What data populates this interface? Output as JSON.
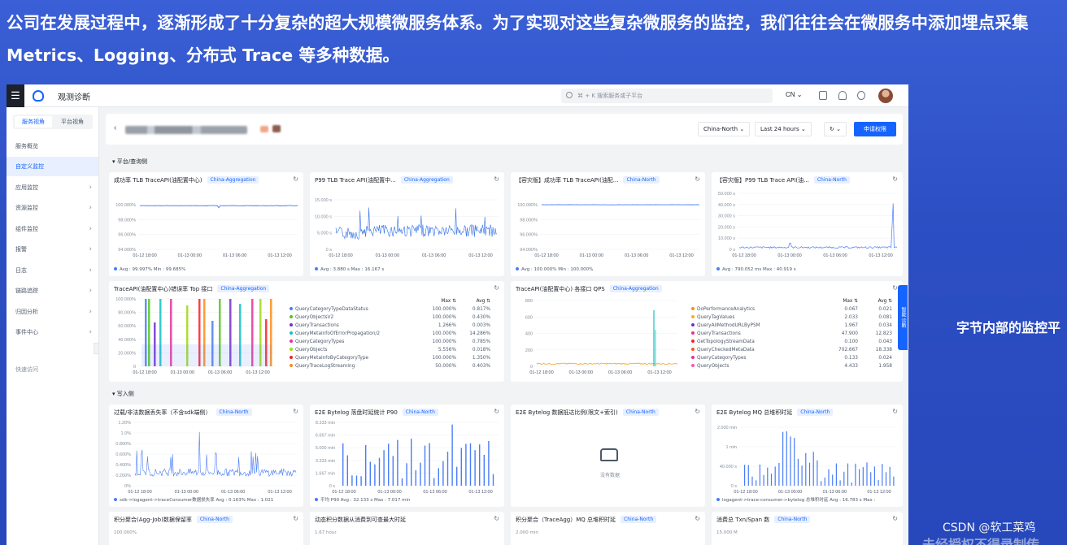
{
  "slide": {
    "heading": "公司在发展过程中，逐渐形成了十分复杂的超大规模微服务体系。为了实现对这些复杂微服务的监控，我们往往会在微服务中添加埋点采集 Metrics、Logging、分布式 Trace 等多种数据。",
    "side_note": "字节内部的监控平",
    "watermark": "CSDN @软工菜鸡",
    "watermark2": "未经授权不得录制传"
  },
  "app": {
    "name": "观测诊断",
    "search_placeholder": "⌘ + K 搜索服务或子平台",
    "lang": "CN ⌄",
    "float_tab": "智能 诊断"
  },
  "sidebar": {
    "seg_on": "服务视角",
    "seg_off": "平台视角",
    "items": [
      {
        "label": "服务概览",
        "chevron": ""
      },
      {
        "label": "自定义监控",
        "chevron": ""
      },
      {
        "label": "应用监控",
        "chevron": "›"
      },
      {
        "label": "资源监控",
        "chevron": "›"
      },
      {
        "label": "组件监控",
        "chevron": "›"
      },
      {
        "label": "报警",
        "chevron": "›"
      },
      {
        "label": "日志",
        "chevron": "›"
      },
      {
        "label": "链路追踪",
        "chevron": "›"
      },
      {
        "label": "归因分析",
        "chevron": "›"
      },
      {
        "label": "事件中心",
        "chevron": "›"
      }
    ],
    "bottom": "快速访问"
  },
  "pagebar": {
    "back": "‹",
    "region": "China-North ⌄",
    "range": "Last 24 hours ⌄",
    "refresh": "↻ ⌄",
    "apply": "申请权限"
  },
  "groups": {
    "g1": "▾ 平台/查询侧",
    "g2": "▾ 写入侧"
  },
  "panels": {
    "p1": {
      "title": "成功率 TLB TraceAPI(油配置中心)",
      "tag": "China-Aggregation",
      "legend": "Avg : 99.997% Min : 99.685%",
      "yticks": [
        "100.000%",
        "98.000%",
        "96.000%",
        "94.000%"
      ],
      "xticks": [
        "01-12 18:00",
        "01-13 00:00",
        "01-13 06:00",
        "01-13 12:00"
      ]
    },
    "p2": {
      "title": "P99 TLB Trace API(油配置中...",
      "tag": "China-Aggregation",
      "legend": "Avg : 3.880 s Max : 16.167 s",
      "yticks": [
        "15.000 s",
        "10.000 s",
        "5.000 s",
        "0 s"
      ],
      "xticks": [
        "01-12 18:00",
        "01-13 00:00",
        "01-13 06:00",
        "01-13 12:00"
      ]
    },
    "p3": {
      "title": "【容灾版】成功率 TLB TraceAPI(油配...",
      "tag": "China-North",
      "legend": "Avg : 100.000% Min : 100.000%",
      "yticks": [
        "100.000%",
        "98.000%",
        "96.000%",
        "94.000%"
      ],
      "xticks": [
        "01-12 18:00",
        "01-13 00:00",
        "01-13 06:00",
        "01-13 12:00"
      ]
    },
    "p4": {
      "title": "【容灾版】P99 TLB Trace API(油...",
      "tag": "China-North",
      "legend": "Avg : 790.052 ms Max : 40.919 s",
      "yticks": [
        "50.000 s",
        "40.000 s",
        "30.000 s",
        "20.000 s",
        "10.000 s",
        "0 s"
      ],
      "xticks": [
        "01-12 18:00",
        "01-13 00:00",
        "01-13 06:00",
        "01-13 12:00"
      ]
    },
    "p5": {
      "title": "TraceAPI(油配置中心)错误率 Top 接口",
      "tag": "China-Aggregation",
      "yticks": [
        "100.000%",
        "80.000%",
        "60.000%",
        "40.000%",
        "20.000%",
        "0"
      ],
      "xticks": [
        "01-12 18:00",
        "01-13 00:00",
        "01-13 06:00",
        "01-13 12:00"
      ],
      "head": {
        "max": "Max ⇅",
        "avg": "Avg ⇅"
      },
      "rows": [
        {
          "name": "QueryCategoryTypeDataStatus",
          "max": "100.000%",
          "avg": "0.817%",
          "color": "#4a7df7"
        },
        {
          "name": "QueryObjectsV2",
          "max": "100.000%",
          "avg": "0.430%",
          "color": "#52c41a"
        },
        {
          "name": "QueryTransactions",
          "max": "1.266%",
          "avg": "0.003%",
          "color": "#722ed1"
        },
        {
          "name": "QueryMetainfoOfErrorPropagation/2",
          "max": "100.000%",
          "avg": "14.286%",
          "color": "#13c2c2"
        },
        {
          "name": "QueryCategoryTypes",
          "max": "100.000%",
          "avg": "0.785%",
          "color": "#eb2f96"
        },
        {
          "name": "QueryObjects",
          "max": "5.556%",
          "avg": "0.018%",
          "color": "#a0d911"
        },
        {
          "name": "QueryMetainfoByCategoryType",
          "max": "100.000%",
          "avg": "1.350%",
          "color": "#f5222d"
        },
        {
          "name": "QueryTraceLogStreaming",
          "max": "50.000%",
          "avg": "0.403%",
          "color": "#fa8c16"
        }
      ]
    },
    "p6": {
      "title": "TraceAPI(油配置中心) 各接口 QPS",
      "tag": "China-Aggregation",
      "yticks": [
        "800",
        "600",
        "400",
        "200",
        "0"
      ],
      "xticks": [
        "01-12 18:00",
        "01-13 00:00",
        "01-13 06:00",
        "01-13 12:00"
      ],
      "head": {
        "max": "Max ⇅",
        "avg": "Avg ⇅"
      },
      "rows": [
        {
          "name": "DoPerformanceAnalytics",
          "max": "0.067",
          "avg": "0.021",
          "color": "#fa8c16"
        },
        {
          "name": "QueryTagValues",
          "max": "2.033",
          "avg": "0.081",
          "color": "#faad14"
        },
        {
          "name": "QueryAllMethodURLByPSM",
          "max": "1.967",
          "avg": "0.034",
          "color": "#722ed1"
        },
        {
          "name": "QueryTransactions",
          "max": "47.900",
          "avg": "12.823",
          "color": "#eb2f96"
        },
        {
          "name": "GetTopologyStreamData",
          "max": "0.100",
          "avg": "0.043",
          "color": "#f5222d"
        },
        {
          "name": "QueryCheckedMetaData",
          "max": "702.667",
          "avg": "18.338",
          "color": "#fa541c"
        },
        {
          "name": "QueryCategoryTypes",
          "max": "0.133",
          "avg": "0.024",
          "color": "#eb2f96"
        },
        {
          "name": "QueryObjects",
          "max": "4.433",
          "avg": "1.958",
          "color": "#f759ab"
        }
      ]
    },
    "p7": {
      "title": "过载/非法数据丢失率（不含sdk端侧）",
      "tag": "China-North",
      "legend": "sdk->logagent->traceConsumer数据损失率 Avg : 0.163% Max : 1.021",
      "yticks": [
        "1.20%",
        "1.0%",
        "0.800%",
        "0.600%",
        "0.400%",
        "0.200%",
        "0%"
      ],
      "xticks": [
        "01-12 18:00",
        "01-13 00:00",
        "01-13 06:00",
        "01-13 12:00"
      ]
    },
    "p8": {
      "title": "E2E Bytelog 落盘时延统计 P90",
      "tag": "China-North",
      "legend": "平均 P90 Avg : 32.133 s Max : 7.017 min",
      "yticks": [
        "8.333 min",
        "6.667 min",
        "5.000 min",
        "3.333 min",
        "1.667 min",
        "0 s"
      ],
      "xticks": [
        "01-12 18:00",
        "01-13 00:00",
        "01-13 06:00",
        "01-13 12:00"
      ]
    },
    "p9": {
      "title": "E2E Bytelog 数据抵达比例(限文+索引)",
      "tag": "China-North",
      "nodata": "没有数据"
    },
    "p10": {
      "title": "E2E Bytelog MQ 总堆积时延",
      "tag": "China-North",
      "legend": "logagent->trace-consumer->bytelog 总堆积时延 Avg : 16.783 s Max :",
      "yticks": [
        "2.000 min",
        "1 min",
        "40.000 s",
        "0 s"
      ],
      "xticks": [
        "01-12 18:00",
        "01-13 00:00",
        "01-13 06:00",
        "01-13 12:00"
      ]
    },
    "p11": {
      "title": "积分聚合(Agg-Job)数据保留率",
      "tag": "China-North",
      "ytop": "100.000%"
    },
    "p12": {
      "title": "动态积分数据从消费到可查最大时延",
      "tag": "",
      "ytop": "1.67 hour"
    },
    "p13": {
      "title": "积分聚合（TraceAgg）MQ 总堆积时延",
      "tag": "China-North",
      "ytop": "2.000 min"
    },
    "p14": {
      "title": "消费总 Txn/Span 数",
      "tag": "China-North",
      "ytop": "15.000 M"
    }
  },
  "colors": {
    "accent": "#1664ff",
    "series": "#4a7df7"
  }
}
